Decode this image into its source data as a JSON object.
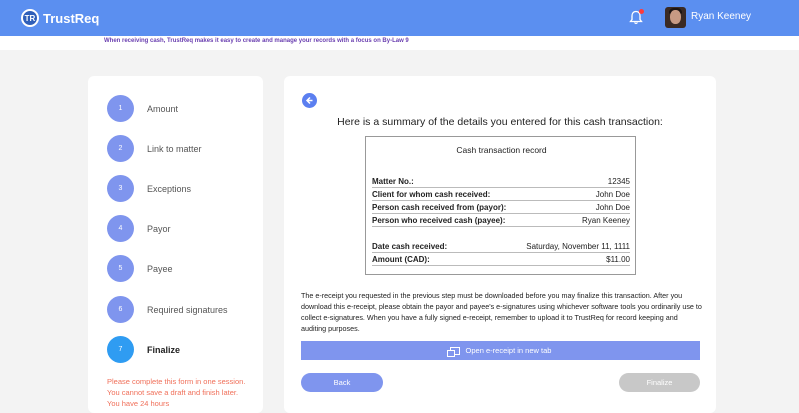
{
  "header": {
    "logo_mark": "TR",
    "logo_text": "TrustReq",
    "user_name": "Ryan Keeney",
    "notification_dot": true
  },
  "notice": "When receiving cash, TrustReq makes it easy to create and manage your records with a focus on By-Law 9",
  "steps": [
    {
      "num": "1",
      "label": "Amount"
    },
    {
      "num": "2",
      "label": "Link to matter"
    },
    {
      "num": "3",
      "label": "Exceptions"
    },
    {
      "num": "4",
      "label": "Payor"
    },
    {
      "num": "5",
      "label": "Payee"
    },
    {
      "num": "6",
      "label": "Required signatures"
    },
    {
      "num": "7",
      "label": "Finalize"
    }
  ],
  "warning": "Please complete this form in one session. You cannot save a draft and finish later. You have 24 hours",
  "summary_title": "Here is a summary of the details you entered for this cash transaction:",
  "record": {
    "title": "Cash transaction record",
    "rows": [
      {
        "k": "Matter No.:",
        "v": "12345"
      },
      {
        "k": "Client for whom cash received:",
        "v": "John Doe"
      },
      {
        "k": "Person cash received from (payor):",
        "v": "John Doe"
      },
      {
        "k": "Person who received cash (payee):",
        "v": "Ryan Keeney"
      },
      {
        "k": "Date cash received:",
        "v": "Saturday, November 11, 1111"
      },
      {
        "k": "Amount (CAD):",
        "v": "$11.00"
      }
    ]
  },
  "body_text": "The e-receipt you requested in the previous step must be downloaded before you may finalize this transaction. After you download this e-receipt, please obtain the payor and payee's e-signatures using whichever software tools you ordinarily use to collect e-signatures. When you have a fully signed e-receipt, remember to upload it to TrustReq for record keeping and auditing purposes.",
  "buttons": {
    "open_receipt": "Open e-receipt in new tab",
    "back": "Back",
    "finalize": "Finalize"
  },
  "colors": {
    "header": "#5b8ff0",
    "step": "#7f95ee",
    "active_step": "#2f9cf2",
    "warning": "#f0705a"
  }
}
